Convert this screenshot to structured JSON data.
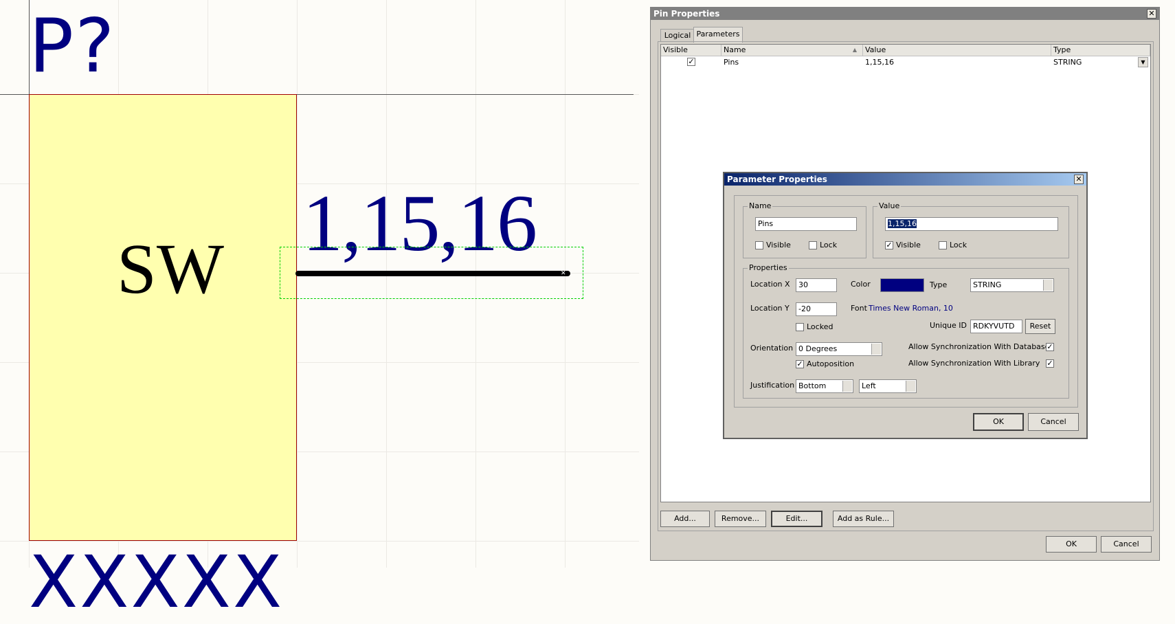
{
  "canvas": {
    "designator": "P?",
    "comment": "SW",
    "pin_name": "1,15,16",
    "bottom_text": "XXXXX"
  },
  "pin_dialog": {
    "title": "Pin Properties",
    "close": "✕",
    "tabs": [
      {
        "label": "Logical",
        "active": false
      },
      {
        "label": "Parameters",
        "active": true
      }
    ],
    "columns": {
      "visible": "Visible",
      "name": "Name",
      "value": "Value",
      "type": "Type",
      "sort_indicator": "▲"
    },
    "rows": [
      {
        "visible": true,
        "name": "Pins",
        "value": "1,15,16",
        "type": "STRING"
      }
    ],
    "buttons": {
      "add": "Add...",
      "remove": "Remove...",
      "edit": "Edit...",
      "add_rule": "Add as Rule...",
      "ok": "OK",
      "cancel": "Cancel"
    }
  },
  "param_dialog": {
    "title": "Parameter Properties",
    "close": "✕",
    "name_group": {
      "label": "Name",
      "value": "Pins",
      "visible_label": "Visible",
      "visible_checked": false,
      "lock_label": "Lock",
      "lock_checked": false
    },
    "value_group": {
      "label": "Value",
      "value": "1,15,16",
      "visible_label": "Visible",
      "visible_checked": true,
      "lock_label": "Lock",
      "lock_checked": false
    },
    "properties": {
      "label": "Properties",
      "location_x_label": "Location  X",
      "location_x": "30",
      "location_y_label": "Location  Y",
      "location_y": "-20",
      "color_label": "Color",
      "color_value": "#000080",
      "type_label": "Type",
      "type_value": "STRING",
      "font_label": "Font",
      "font_value": "Times New Roman, 10",
      "locked_label": "Locked",
      "locked_checked": false,
      "unique_id_label": "Unique ID",
      "unique_id": "RDKYVUTD",
      "reset": "Reset",
      "orientation_label": "Orientation",
      "orientation": "0 Degrees",
      "autoposition_label": "Autoposition",
      "autoposition_checked": true,
      "sync_db_label": "Allow Synchronization With Database",
      "sync_db_checked": true,
      "sync_lib_label": "Allow Synchronization With Library",
      "sync_lib_checked": true,
      "justification_label": "Justification",
      "justification_v": "Bottom",
      "justification_h": "Left"
    },
    "ok": "OK",
    "cancel": "Cancel"
  },
  "colors": {
    "designator": "#000080",
    "body_fill": "#ffffaf",
    "body_border": "#a00000",
    "selection": "#00d000",
    "title_active": "#0a246a",
    "title_inactive": "#808080"
  }
}
